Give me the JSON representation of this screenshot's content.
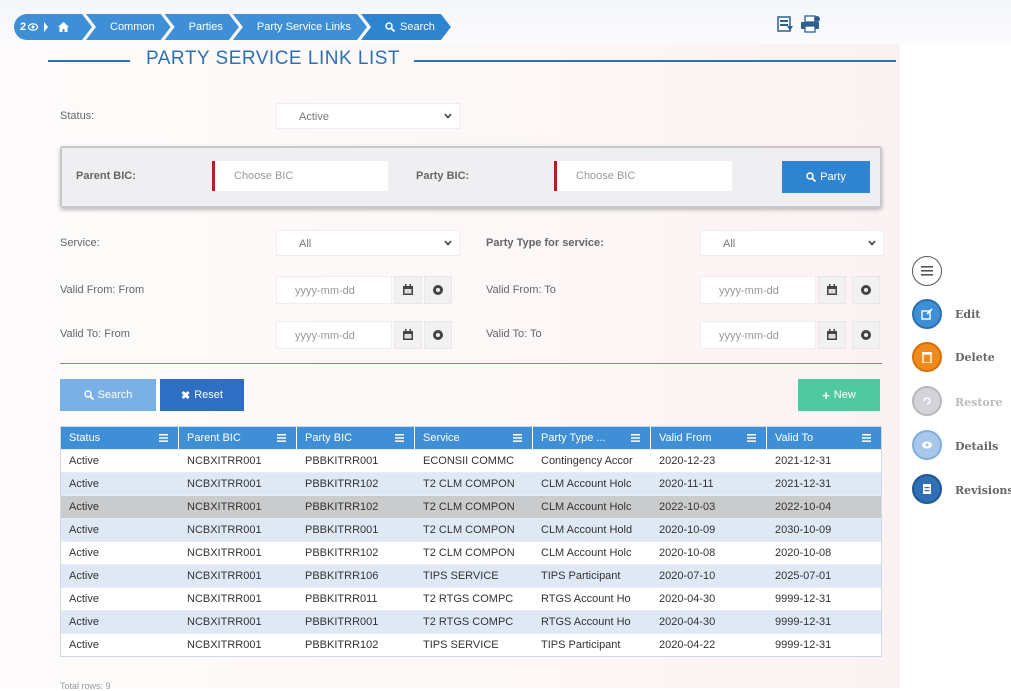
{
  "breadcrumb": {
    "badge": "2",
    "items": [
      "Common",
      "Parties",
      "Party Service Links",
      "Search"
    ]
  },
  "title": "PARTY SERVICE LINK LIST",
  "filters": {
    "status_label": "Status:",
    "status_value": "Active",
    "parent_bic_label": "Parent BIC:",
    "parent_bic_placeholder": "Choose BIC",
    "party_bic_label": "Party BIC:",
    "party_bic_placeholder": "Choose BIC",
    "party_button": "Party",
    "service_label": "Service:",
    "service_value": "All",
    "party_type_label": "Party Type for service:",
    "party_type_value": "All",
    "valid_from_from_label": "Valid From: From",
    "valid_from_to_label": "Valid From: To",
    "valid_to_from_label": "Valid To: From",
    "valid_to_to_label": "Valid To: To",
    "date_placeholder": "yyyy-mm-dd"
  },
  "buttons": {
    "search": "Search",
    "reset": "Reset",
    "new": "New"
  },
  "table": {
    "columns": [
      "Status",
      "Parent BIC",
      "Party BIC",
      "Service",
      "Party Type ...",
      "Valid From",
      "Valid To"
    ],
    "rows": [
      [
        "Active",
        "NCBXITRR001",
        "PBBKITRR001",
        "ECONSII COMMC",
        "Contingency Accor",
        "2020-12-23",
        "2021-12-31"
      ],
      [
        "Active",
        "NCBXITRR001",
        "PBBKITRR102",
        "T2 CLM COMPON",
        "CLM Account Holc",
        "2020-11-11",
        "2021-12-31"
      ],
      [
        "Active",
        "NCBXITRR001",
        "PBBKITRR102",
        "T2 CLM COMPON",
        "CLM Account Holc",
        "2022-10-03",
        "2022-10-04"
      ],
      [
        "Active",
        "NCBXITRR001",
        "PBBKITRR001",
        "T2 CLM COMPON",
        "CLM Account Hold",
        "2020-10-09",
        "2030-10-09"
      ],
      [
        "Active",
        "NCBXITRR001",
        "PBBKITRR102",
        "T2 CLM COMPON",
        "CLM Account Holc",
        "2020-10-08",
        "2020-10-08"
      ],
      [
        "Active",
        "NCBXITRR001",
        "PBBKITRR106",
        "TIPS SERVICE",
        "TIPS Participant",
        "2020-07-10",
        "2025-07-01"
      ],
      [
        "Active",
        "NCBXITRR001",
        "PBBKITRR011",
        "T2 RTGS COMPC",
        "RTGS Account Ho",
        "2020-04-30",
        "9999-12-31"
      ],
      [
        "Active",
        "NCBXITRR001",
        "PBBKITRR001",
        "T2 RTGS COMPC",
        "RTGS Account Ho",
        "2020-04-30",
        "9999-12-31"
      ],
      [
        "Active",
        "NCBXITRR001",
        "PBBKITRR102",
        "TIPS SERVICE",
        "TIPS Participant",
        "2020-04-22",
        "9999-12-31"
      ]
    ]
  },
  "total_rows": "Total rows: 9",
  "side_actions": {
    "edit": "Edit",
    "delete": "Delete",
    "restore": "Restore",
    "details": "Details",
    "revisions": "Revisions"
  },
  "colors": {
    "accent": "#3f8fd6",
    "reset": "#2e6fc4",
    "new": "#4ec9a0",
    "delete": "#f08a1a",
    "required_mark": "#b42020"
  }
}
